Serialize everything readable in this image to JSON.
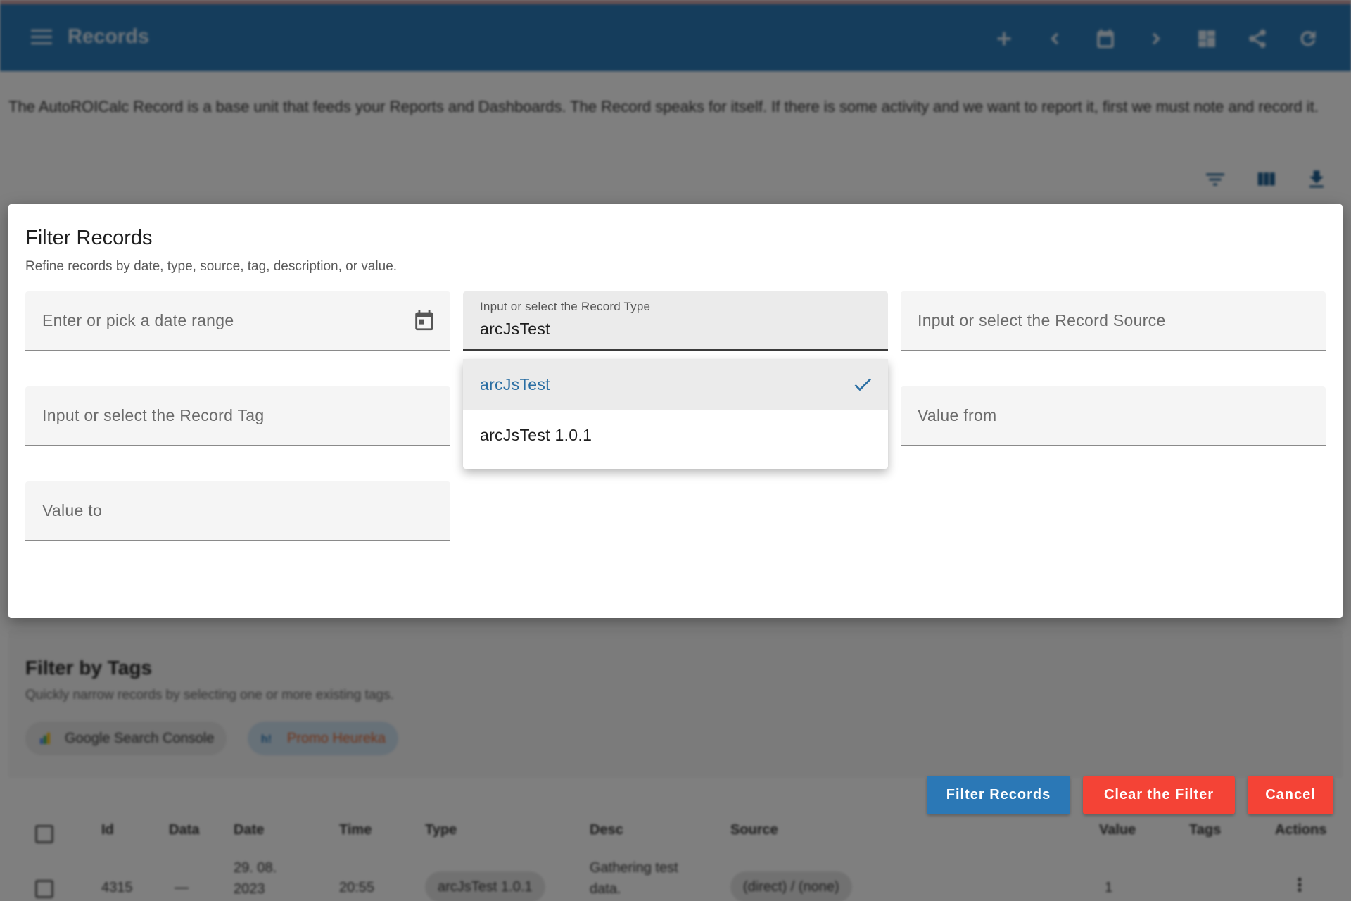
{
  "app": {
    "title": "Records",
    "colors": {
      "primary": "#2b7bb9",
      "danger": "#f44336",
      "selected_text": "#2a6ea3"
    },
    "toolbar_icons": [
      "add-icon",
      "chevron-left-icon",
      "calendar-icon",
      "chevron-right-icon",
      "dashboard-icon",
      "share-icon",
      "refresh-icon"
    ]
  },
  "page": {
    "description": "The AutoROICalc Record is a base unit that feeds your Reports and Dashboards. The Record speaks for itself. If there is some activity and we want to report it, first we must note and record it.",
    "tool_icons": [
      "filter-icon",
      "columns-icon",
      "download-icon"
    ]
  },
  "dialog": {
    "title": "Filter Records",
    "subtitle": "Refine records by date, type, source, tag, description, or value.",
    "date_range": {
      "placeholder": "Enter or pick a date range"
    },
    "record_type": {
      "label": "Input or select the Record Type",
      "value": "arcJsTest",
      "options": [
        {
          "label": "arcJsTest",
          "selected": true
        },
        {
          "label": "arcJsTest 1.0.1",
          "selected": false
        }
      ]
    },
    "record_source": {
      "placeholder": "Input or select the Record Source"
    },
    "record_tag": {
      "placeholder": "Input or select the Record Tag"
    },
    "value_from": {
      "placeholder": "Value from"
    },
    "value_to": {
      "placeholder": "Value to"
    },
    "buttons": {
      "filter": "Filter Records",
      "clear": "Clear the Filter",
      "cancel": "Cancel"
    }
  },
  "tags_section": {
    "title": "Filter by Tags",
    "subtitle": "Quickly narrow records by selecting one or more existing tags.",
    "chips": [
      "Google Search Console",
      "Promo Heureka"
    ]
  },
  "table": {
    "headers": [
      "Id",
      "Data",
      "Date",
      "Time",
      "Type",
      "Desc",
      "Source",
      "Value",
      "Tags",
      "Actions"
    ],
    "rows": [
      {
        "id": "4315",
        "data": "—",
        "date_line1": "29. 08.",
        "date_line2": "2023",
        "time": "20:55",
        "type": "arcJsTest 1.0.1",
        "desc_line1": "Gathering test",
        "desc_line2": "data.",
        "source": "(direct) / (none)",
        "value": "1"
      }
    ]
  }
}
